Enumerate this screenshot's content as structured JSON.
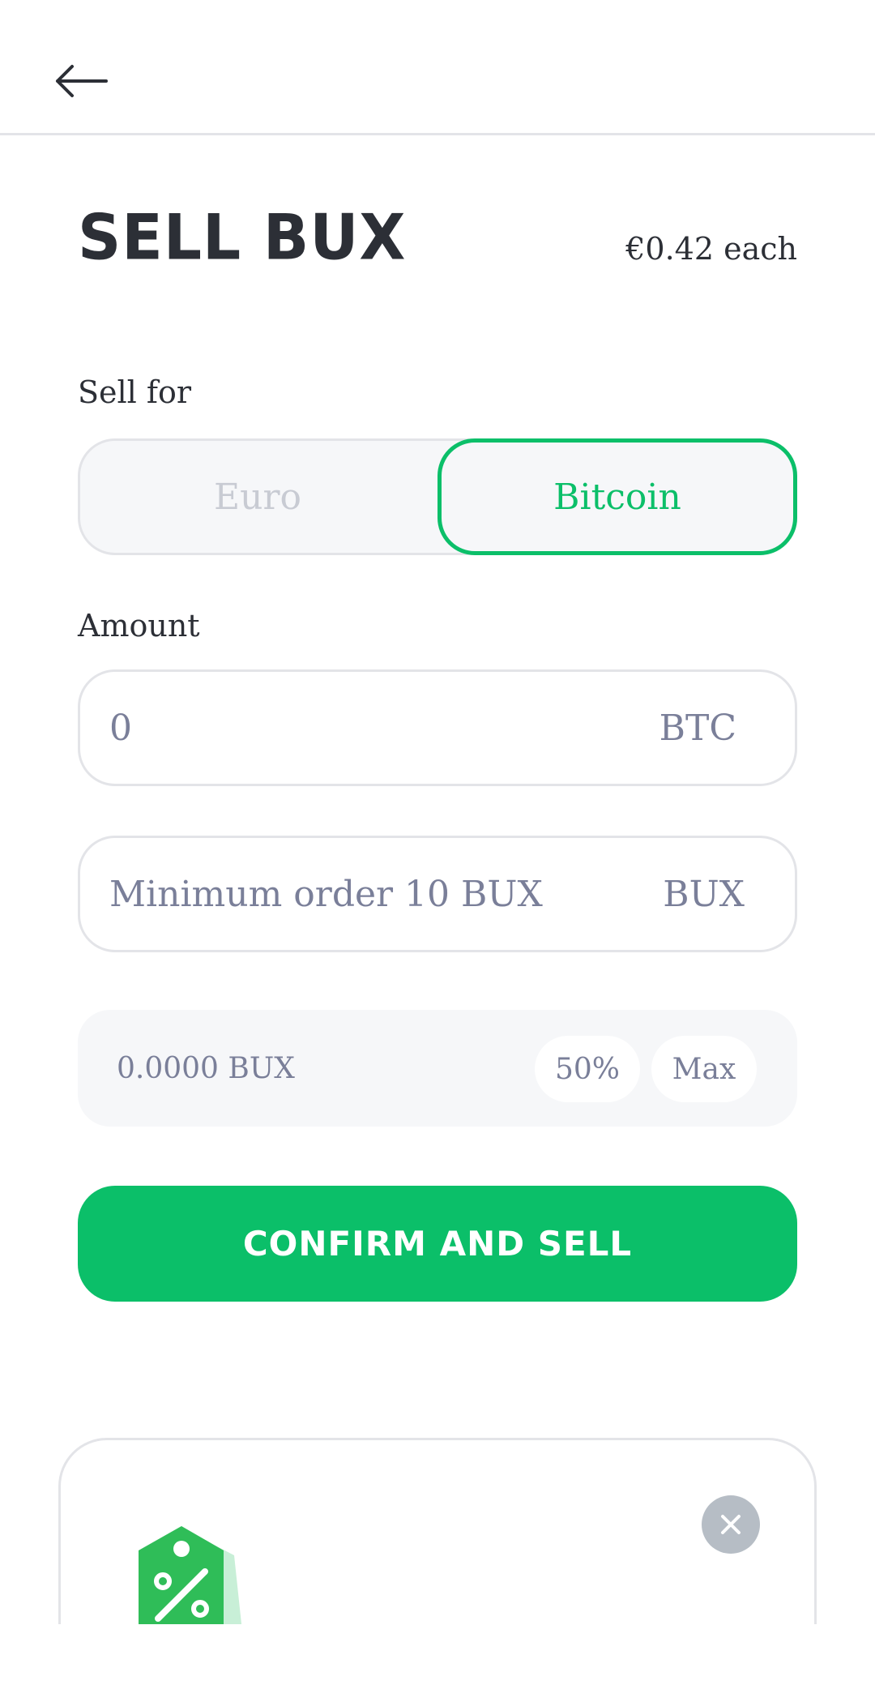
{
  "header": {
    "back_icon": "arrow-left-icon"
  },
  "page": {
    "title": "SELL BUX",
    "price_each": "€0.42 each"
  },
  "sell_for": {
    "label": "Sell for",
    "options": [
      "Euro",
      "Bitcoin"
    ],
    "selected": "Bitcoin"
  },
  "amount": {
    "label": "Amount",
    "btc_field": {
      "value": "",
      "placeholder": "0",
      "unit": "BTC"
    },
    "bux_field": {
      "value": "",
      "placeholder": "Minimum order 10 BUX",
      "unit": "BUX"
    }
  },
  "balance": {
    "text": "0.0000 BUX",
    "chip_half": "50%",
    "chip_max": "Max"
  },
  "actions": {
    "confirm_label": "CONFIRM AND SELL"
  },
  "promo": {
    "icon": "percent-tag-icon",
    "close_icon": "close-icon"
  },
  "colors": {
    "accent": "#0bbf69",
    "text": "#2c2f36",
    "muted": "#7a7f99",
    "border": "#e3e4e8",
    "surface": "#f6f7f9"
  }
}
